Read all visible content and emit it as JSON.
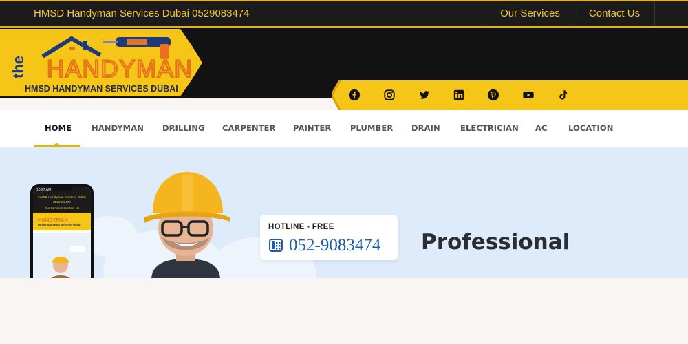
{
  "topbar": {
    "brand": "HMSD Handyman Services Dubai 0529083474",
    "links": [
      "Our Services",
      "Contact Us"
    ]
  },
  "logo": {
    "the": "the",
    "name": "HANDYMAN",
    "tagline": "HMSD HANDYMAN SERVICES  DUBAI"
  },
  "social": [
    "facebook-icon",
    "instagram-icon",
    "twitter-icon",
    "linkedin-icon",
    "pinterest-icon",
    "youtube-icon",
    "tiktok-icon"
  ],
  "nav": {
    "items": [
      "HOME",
      "HANDYMAN",
      "DRILLING",
      "CARPENTER",
      "PAINTER",
      "PLUMBER",
      "DRAIN",
      "ELECTRICIAN",
      "AC",
      "LOCATION"
    ],
    "active": "HOME"
  },
  "hero": {
    "hotline_label": "HOTLINE - FREE",
    "hotline_number": "052-9083474",
    "headline": "Professional"
  },
  "mobile_preview": {
    "time": "10:27 AM",
    "top_text": "HMSD Handyman Services Dubai 0529083474",
    "links": "Our Services   Contact Us",
    "logo": "HANDYMAN",
    "logo_sub": "HMSD HANDYMAN SERVICES DUBAI",
    "url": "handyman-service-dubai.com"
  },
  "colors": {
    "brand_yellow": "#f5c518",
    "dark": "#121212",
    "accent_orange": "#e8721c",
    "hotline_blue": "#1c5fa8"
  }
}
